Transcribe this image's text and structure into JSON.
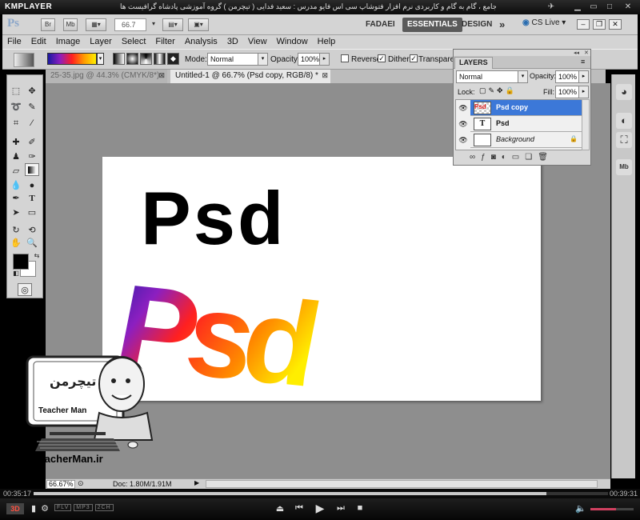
{
  "player": {
    "logo": "KMPLAYER",
    "caption": "مجموعه آموزشی جامع ، گام به گام و کاربردی نرم افزار فتوشاپ سی اس فایو   مدرس : سعید فدایی ( تیچرمن ) گروه آموزشی پادشاه گرافیست ها",
    "time_elapsed": "00:35:17",
    "time_total": "00:39:31",
    "progress_fraction": 0.893,
    "volume_fraction": 0.6,
    "badges": [
      "3D",
      "FLV",
      "MP3",
      "2CH"
    ]
  },
  "appbar": {
    "logo": "Ps",
    "btn_br": "Br",
    "btn_mb": "Mb",
    "zoom": "66.7",
    "workspaces": [
      "FADAEI",
      "ESSENTIALS",
      "DESIGN"
    ],
    "more": "»",
    "cslive": "CS Live"
  },
  "menu": [
    "File",
    "Edit",
    "Image",
    "Layer",
    "Select",
    "Filter",
    "Analysis",
    "3D",
    "View",
    "Window",
    "Help"
  ],
  "options": {
    "mode_label": "Mode:",
    "mode_value": "Normal",
    "opacity_label": "Opacity:",
    "opacity_value": "100%",
    "reverse_label": "Reverse",
    "dither_label": "Dither",
    "transparency_label": "Transparency"
  },
  "tabs": [
    {
      "label": "25-35.jpg @ 44.3% (CMYK/8*)"
    },
    {
      "label": "Untitled-1 @ 66.7% (Psd copy, RGB/8) *"
    }
  ],
  "canvas": {
    "text_black": "Psd",
    "text_gradient": "Psd"
  },
  "layers": {
    "title": "LAYERS",
    "blend": "Normal",
    "opacity_label": "Opacity:",
    "opacity_value": "100%",
    "lock_label": "Lock:",
    "fill_label": "Fill:",
    "fill_value": "100%",
    "rows": [
      {
        "name": "Psd copy",
        "selected": true
      },
      {
        "name": "Psd",
        "selected": false
      },
      {
        "name": "Background",
        "selected": false
      }
    ],
    "text_thumb": "T"
  },
  "status": {
    "zoom": "66.67%",
    "doc": "Doc: 1.80M/1.91M"
  },
  "watermark": {
    "brand": "Teacher Man",
    "url": "www.TeacherMan.ir"
  },
  "colors": {
    "accent_selected_layer": "#3c78d8",
    "gradient": [
      "#1a1aa0",
      "#8c1fc0",
      "#ff2020",
      "#ff9900",
      "#ffee00"
    ]
  }
}
